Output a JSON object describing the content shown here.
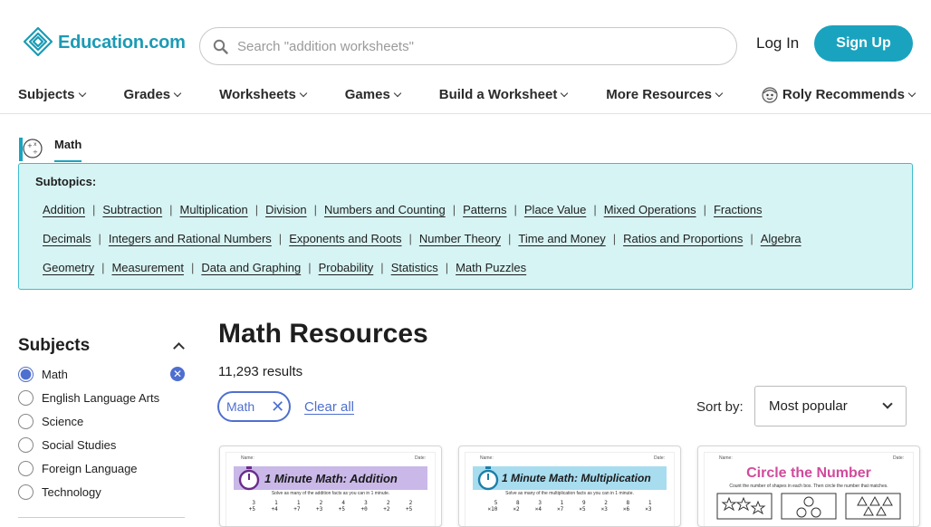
{
  "header": {
    "logo_text": "Education.com",
    "search_placeholder": "Search \"addition worksheets\"",
    "login_label": "Log In",
    "signup_label": "Sign Up"
  },
  "nav": {
    "items": [
      {
        "label": "Subjects"
      },
      {
        "label": "Grades"
      },
      {
        "label": "Worksheets"
      },
      {
        "label": "Games"
      },
      {
        "label": "Build a Worksheet"
      },
      {
        "label": "More Resources"
      },
      {
        "label": "Roly Recommends"
      }
    ]
  },
  "math_tab": {
    "label": "Math"
  },
  "subtopics": {
    "title": "Subtopics:",
    "rows": [
      [
        "Addition",
        "Subtraction",
        "Multiplication",
        "Division",
        "Numbers and Counting",
        "Patterns",
        "Place Value",
        "Mixed Operations",
        "Fractions"
      ],
      [
        "Decimals",
        "Integers and Rational Numbers",
        "Exponents and Roots",
        "Number Theory",
        "Time and Money",
        "Ratios and Proportions",
        "Algebra"
      ],
      [
        "Geometry",
        "Measurement",
        "Data and Graphing",
        "Probability",
        "Statistics",
        "Math Puzzles"
      ]
    ]
  },
  "sidebar": {
    "title": "Subjects",
    "items": [
      {
        "label": "Math",
        "checked": true
      },
      {
        "label": "English Language Arts",
        "checked": false
      },
      {
        "label": "Science",
        "checked": false
      },
      {
        "label": "Social Studies",
        "checked": false
      },
      {
        "label": "Foreign Language",
        "checked": false
      },
      {
        "label": "Technology",
        "checked": false
      }
    ]
  },
  "main": {
    "title": "Math Resources",
    "results": "11,293 results",
    "filter_chip": "Math",
    "clear_all": "Clear all",
    "sort_label": "Sort by:",
    "sort_value": "Most popular"
  },
  "cards": [
    {
      "title": "1 Minute Math: Addition",
      "subtitle": "Solve as many of the addition facts as you can in 1 minute.",
      "fields": [
        "Name:",
        "Date:"
      ],
      "highlight": "#c9b8e8",
      "problems": [
        [
          "3",
          "+5"
        ],
        [
          "1",
          "+4"
        ],
        [
          "1",
          "+7"
        ],
        [
          "2",
          "+3"
        ],
        [
          "4",
          "+5"
        ],
        [
          "3",
          "+0"
        ],
        [
          "2",
          "+2"
        ],
        [
          "2",
          "+5"
        ]
      ]
    },
    {
      "title": "1 Minute Math: Multiplication",
      "subtitle": "Solve as many of the multiplication facts as you can in 1 minute.",
      "fields": [
        "Name:",
        "Date:"
      ],
      "highlight": "#a8dcef",
      "problems": [
        [
          "5",
          "×10"
        ],
        [
          "8",
          "×2"
        ],
        [
          "3",
          "×4"
        ],
        [
          "1",
          "×7"
        ],
        [
          "9",
          "×5"
        ],
        [
          "2",
          "×3"
        ],
        [
          "8",
          "×6"
        ],
        [
          "1",
          "×3"
        ]
      ]
    },
    {
      "title": "Circle the Number",
      "subtitle": "Count the number of shapes in each box. Then circle the number that matches.",
      "fields": [
        "Name:",
        "Date:"
      ],
      "title_color": "#d14a9c"
    }
  ]
}
